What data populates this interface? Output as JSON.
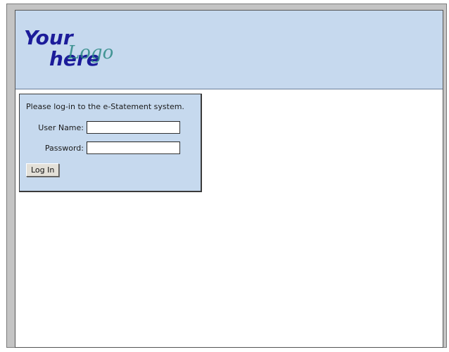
{
  "header": {
    "logo_your": "Your",
    "logo_here": "here",
    "logo_script": "Logo"
  },
  "login": {
    "message": "Please log-in to the e-Statement system.",
    "username_label": "User Name:",
    "username_value": "",
    "password_label": "Password:",
    "password_value": "",
    "submit_label": "Log In"
  },
  "colors": {
    "header_bg": "#c6d9ee",
    "logo_blue": "#1c1c9a",
    "logo_script": "#2d8a86"
  }
}
